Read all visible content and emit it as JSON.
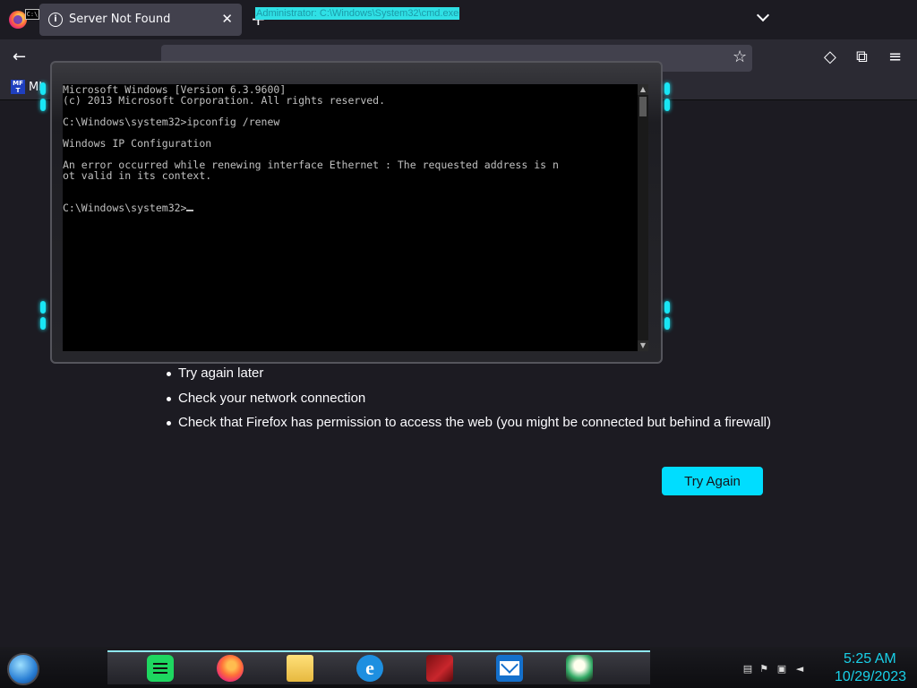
{
  "browser": {
    "tab": {
      "title": "Server Not Found",
      "close": "✕"
    },
    "new_tab": "+",
    "nav": {
      "back": "←",
      "bookmark_star": "☆",
      "pocket": "◇",
      "extensions": "⧉",
      "menu": "≡"
    },
    "bookmarks": [
      {
        "icon_text": "MF T",
        "label": "MI"
      }
    ]
  },
  "error_page": {
    "suggestions": [
      "Try again later",
      "Check your network connection",
      "Check that Firefox has permission to access the web (you might be connected but behind a firewall)"
    ],
    "try_again_label": "Try Again",
    "accent": "#00ddff"
  },
  "cmd_window": {
    "title": "Administrator: C:\\Windows\\System32\\cmd.exe",
    "sys_icon": "C:\\",
    "lines": [
      "Microsoft Windows [Version 6.3.9600]",
      "(c) 2013 Microsoft Corporation. All rights reserved.",
      "",
      "C:\\Windows\\system32>ipconfig /renew",
      "",
      "Windows IP Configuration",
      "",
      "An error occurred while renewing interface Ethernet : The requested address is n",
      "ot valid in its context.",
      "",
      ""
    ],
    "prompt": "C:\\Windows\\system32>",
    "scroll_up": "▲",
    "scroll_down": "▼"
  },
  "taskbar": {
    "apps": [
      "spotify-icon",
      "firefox-icon",
      "file-explorer-icon",
      "internet-explorer-icon",
      "red-app-icon",
      "mail-icon",
      "flower-app-icon"
    ],
    "ie_glyph": "e",
    "tray": {
      "time": "5:25 AM",
      "date": "10/29/2023"
    },
    "clock_color": "#19d0e8"
  }
}
